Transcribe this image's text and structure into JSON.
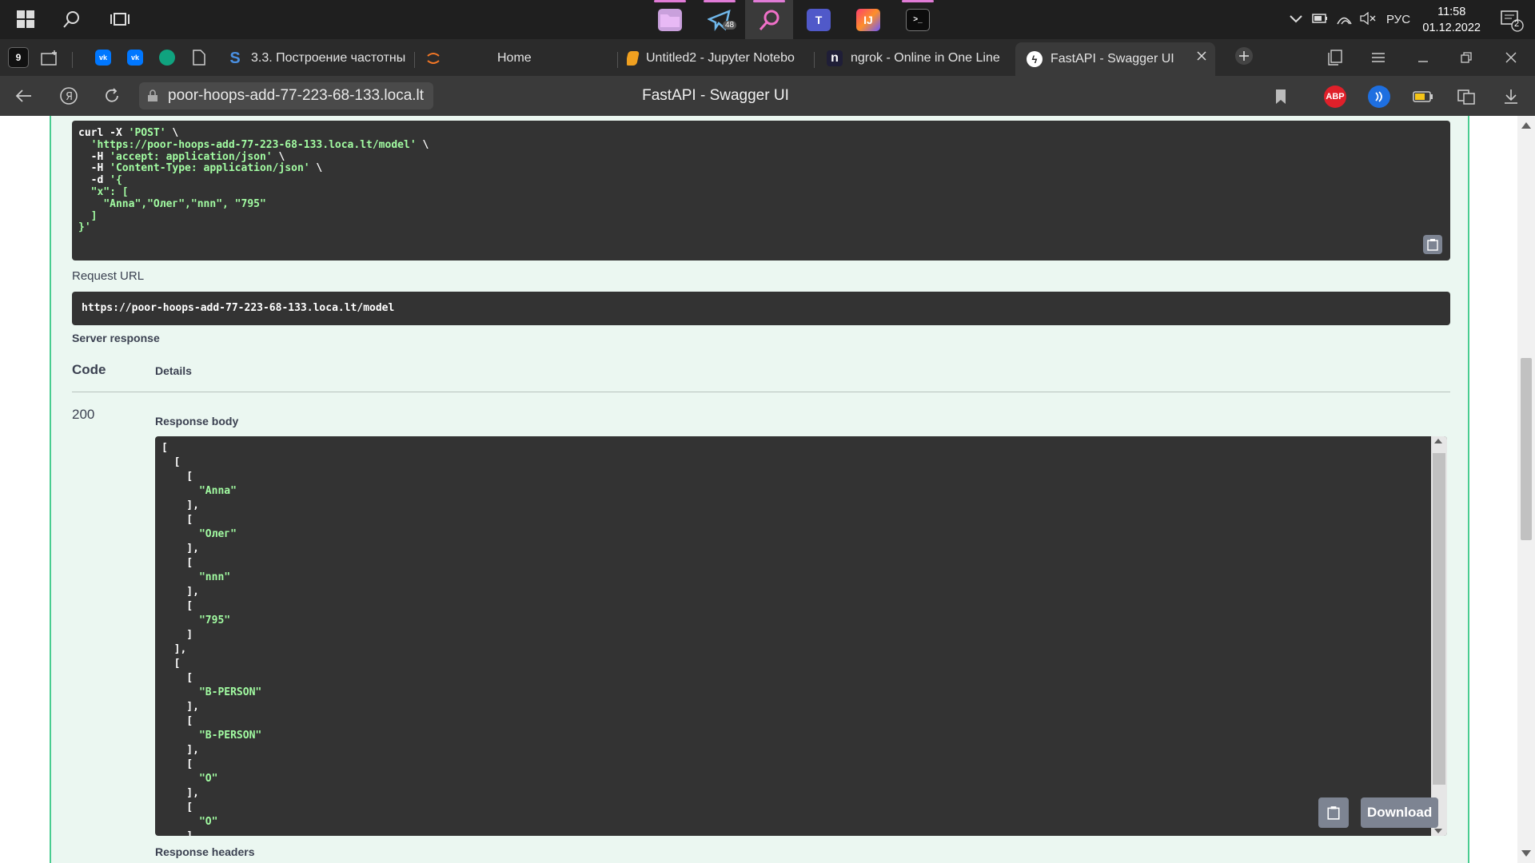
{
  "taskbar": {
    "time": "11:58",
    "date": "01.12.2022",
    "language": "РУС",
    "notification_count": "2",
    "telegram_badge": "48"
  },
  "tabs": {
    "workspace_count": "9",
    "items": [
      {
        "label": "3.3. Построение частотны"
      },
      {
        "label": "Home"
      },
      {
        "label": "Untitled2 - Jupyter Notebo"
      },
      {
        "label": "ngrok - Online in One Line"
      },
      {
        "label": "FastAPI - Swagger UI"
      }
    ]
  },
  "addressbar": {
    "url": "poor-hoops-add-77-223-68-133.loca.lt",
    "page_title": "FastAPI - Swagger UI",
    "ext_abp": "ABP"
  },
  "curl": {
    "lines": [
      [
        "curl -X ",
        "'POST'",
        " \\"
      ],
      [
        "  ",
        "'https://poor-hoops-add-77-223-68-133.loca.lt/model'",
        " \\"
      ],
      [
        "  -H ",
        "'accept: application/json'",
        " \\"
      ],
      [
        "  -H ",
        "'Content-Type: application/json'",
        " \\"
      ],
      [
        "  -d ",
        "'{",
        ""
      ],
      [
        "  ",
        "\"x\": [",
        ""
      ],
      [
        "    ",
        "\"Anna\",\"Олег\",\"nnn\", \"795\"",
        ""
      ],
      [
        "  ",
        "]",
        ""
      ],
      [
        "",
        "}'",
        ""
      ]
    ]
  },
  "request_url": {
    "label": "Request URL",
    "value": "https://poor-hoops-add-77-223-68-133.loca.lt/model"
  },
  "server_response": {
    "label": "Server response",
    "col_code": "Code",
    "col_details": "Details",
    "code": "200",
    "response_body_label": "Response body",
    "response_headers_label": "Response headers",
    "download_label": "Download",
    "body_lines": [
      [
        "[",
        ""
      ],
      [
        "  [",
        ""
      ],
      [
        "    [",
        ""
      ],
      [
        "      ",
        "\"Anna\""
      ],
      [
        "    ],",
        ""
      ],
      [
        "    [",
        ""
      ],
      [
        "      ",
        "\"Олег\""
      ],
      [
        "    ],",
        ""
      ],
      [
        "    [",
        ""
      ],
      [
        "      ",
        "\"nnn\""
      ],
      [
        "    ],",
        ""
      ],
      [
        "    [",
        ""
      ],
      [
        "      ",
        "\"795\""
      ],
      [
        "    ]",
        ""
      ],
      [
        "  ],",
        ""
      ],
      [
        "  [",
        ""
      ],
      [
        "    [",
        ""
      ],
      [
        "      ",
        "\"B-PERSON\""
      ],
      [
        "    ],",
        ""
      ],
      [
        "    [",
        ""
      ],
      [
        "      ",
        "\"B-PERSON\""
      ],
      [
        "    ],",
        ""
      ],
      [
        "    [",
        ""
      ],
      [
        "      ",
        "\"O\""
      ],
      [
        "    ],",
        ""
      ],
      [
        "    [",
        ""
      ],
      [
        "      ",
        "\"O\""
      ],
      [
        "    ]",
        ""
      ]
    ]
  },
  "colors": {
    "accent_green": "#49cc90",
    "code_bg": "#333333",
    "string_green": "#a2fca2"
  }
}
